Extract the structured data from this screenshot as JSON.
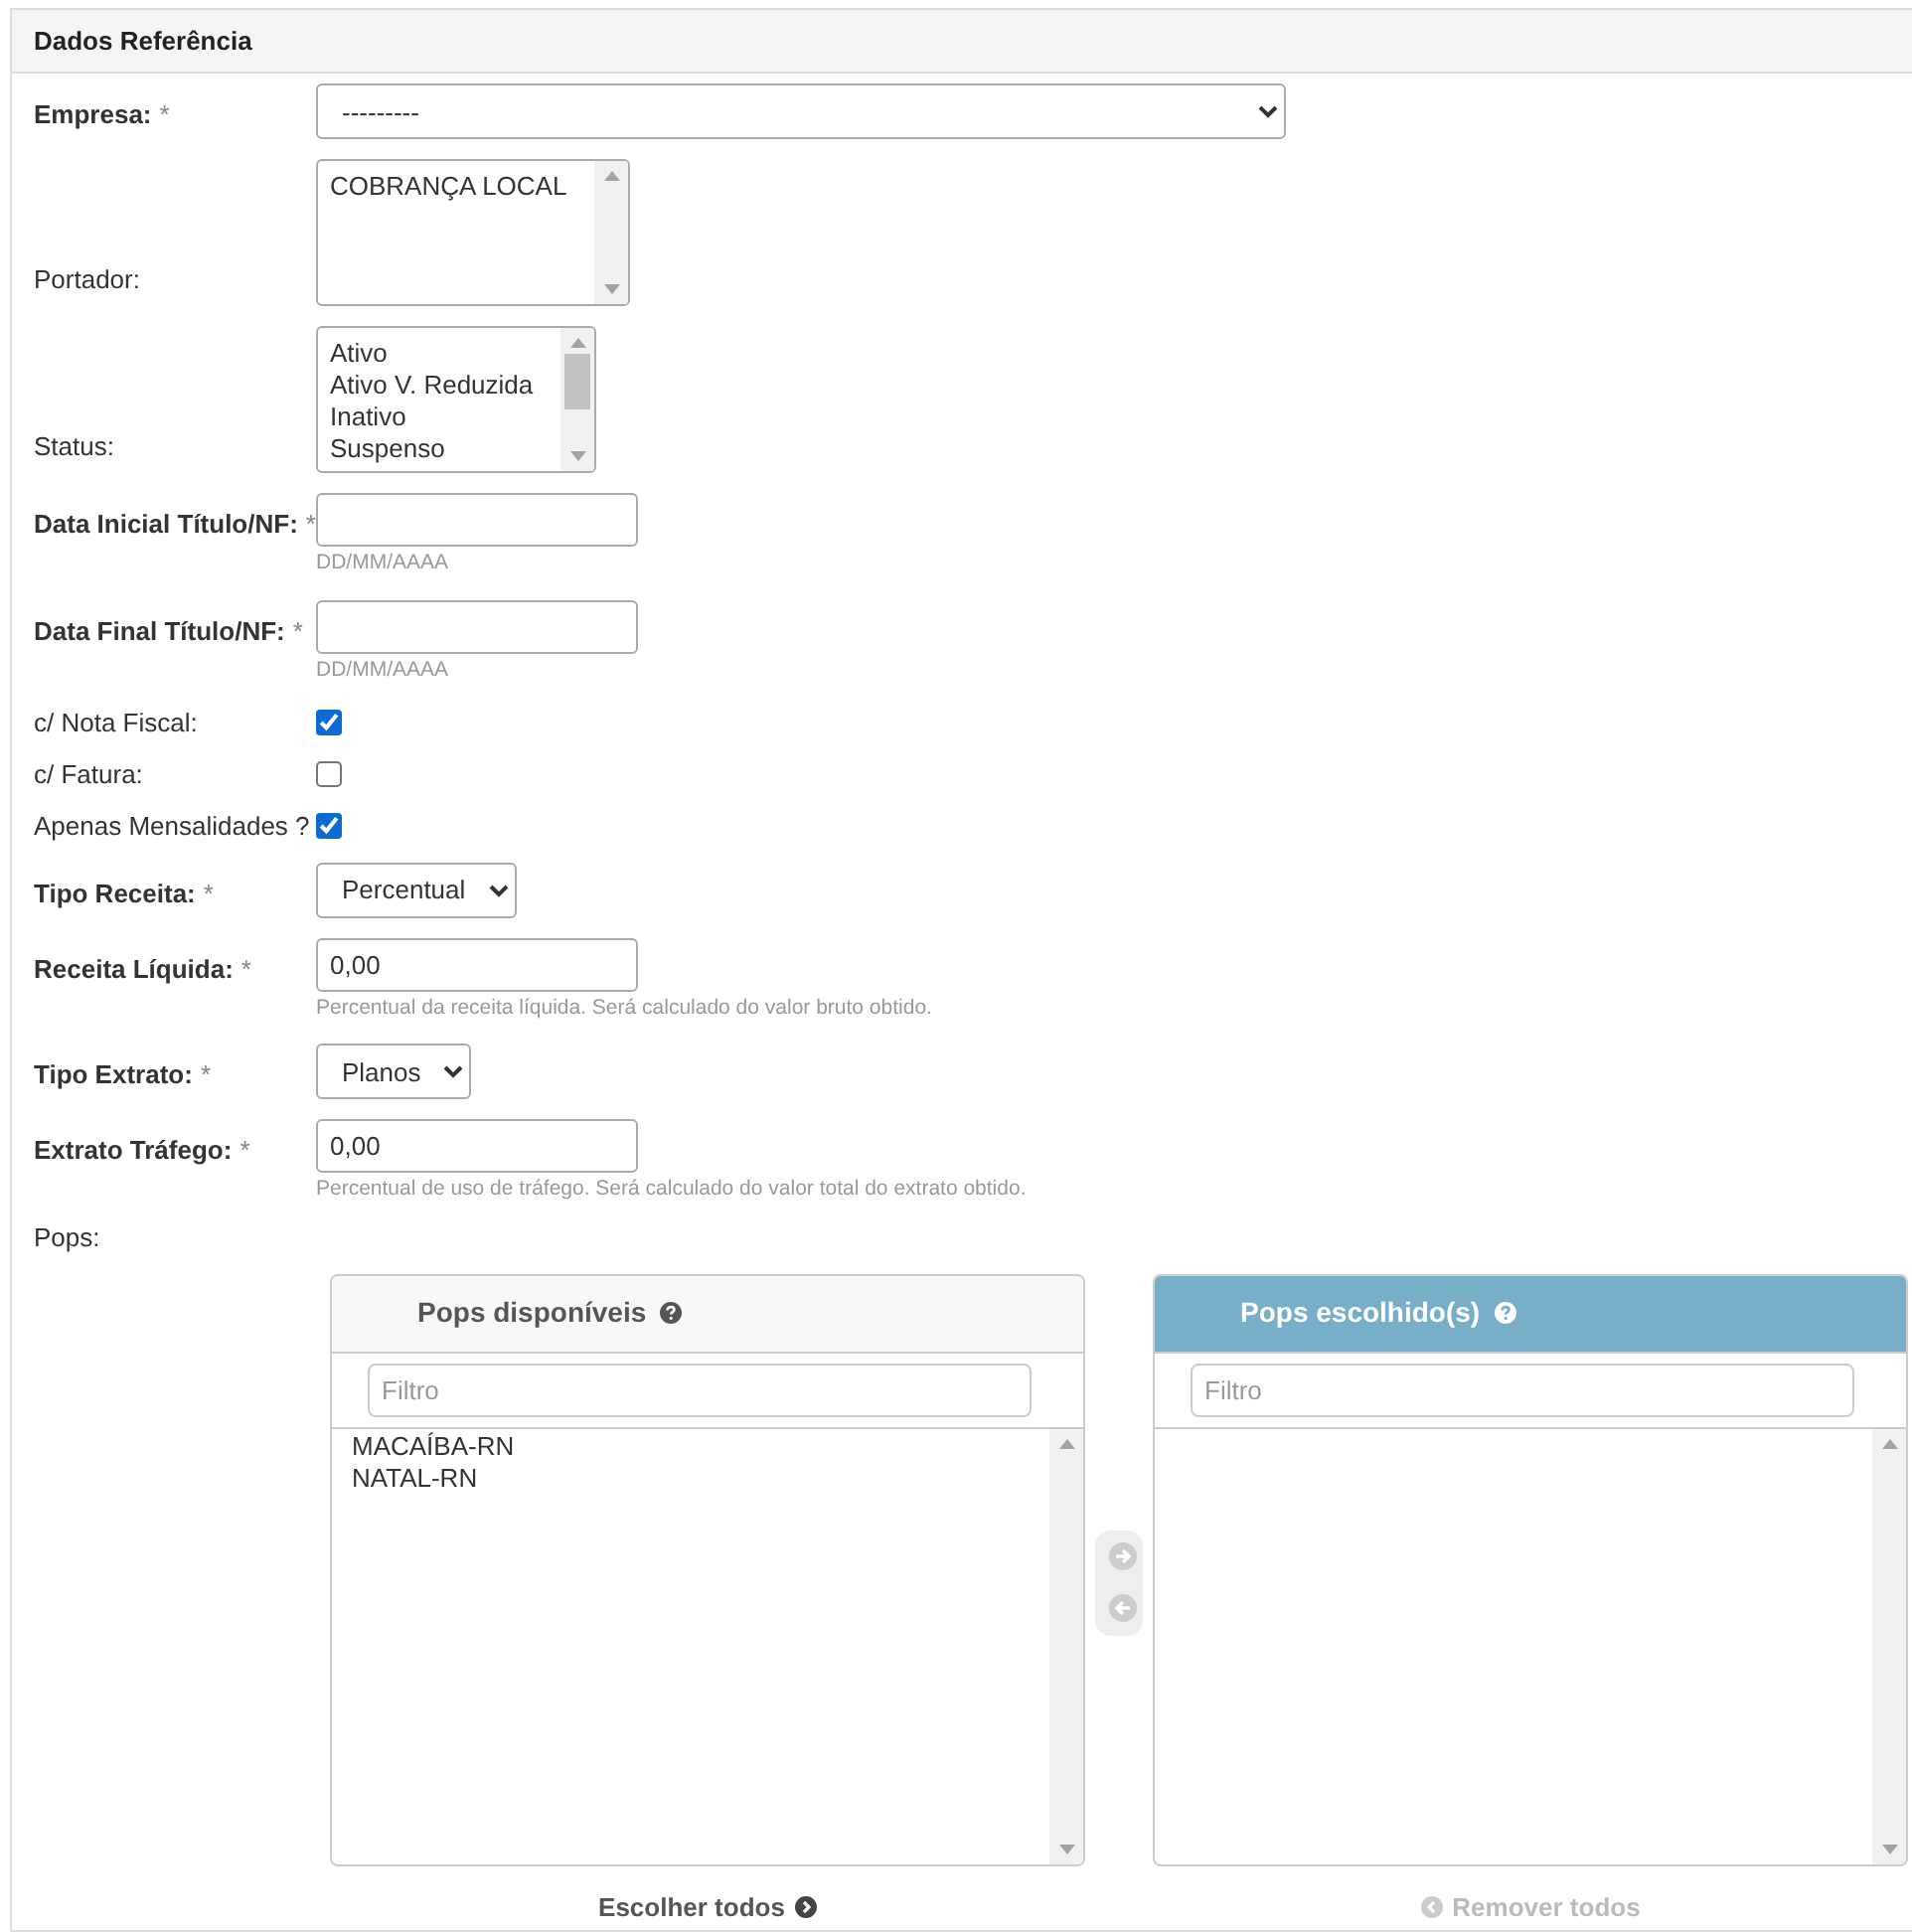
{
  "panel": {
    "title": "Dados Referência"
  },
  "fields": [
    {
      "kind": "select",
      "label": "Empresa:",
      "required_mark": "*",
      "value": "---------"
    },
    {
      "kind": "listbox",
      "label": "Portador:",
      "items": [
        "COBRANÇA LOCAL"
      ]
    },
    {
      "kind": "listbox",
      "label": "Status:",
      "items": [
        "Ativo",
        "Ativo V. Reduzida",
        "Inativo",
        "Suspenso"
      ]
    },
    {
      "kind": "text",
      "label": "Data Inicial Título/NF:",
      "required_mark": "*",
      "help": "DD/MM/AAAA"
    },
    {
      "kind": "text",
      "label": "Data Final Título/NF:",
      "required_mark": "*",
      "help": "DD/MM/AAAA"
    },
    {
      "kind": "checkbox",
      "label": "c/ Nota Fiscal:",
      "checked": true
    },
    {
      "kind": "checkbox",
      "label": "c/ Fatura:",
      "checked": false
    },
    {
      "kind": "checkbox",
      "label": "Apenas Mensalidades ?",
      "checked": true
    },
    {
      "kind": "select",
      "label": "Tipo Receita:",
      "required_mark": "*",
      "value": "Percentual"
    },
    {
      "kind": "text",
      "label": "Receita Líquida:",
      "required_mark": "*",
      "value": "0,00",
      "help": "Percentual da receita líquida. Será calculado do valor bruto obtido."
    },
    {
      "kind": "select",
      "label": "Tipo Extrato:",
      "required_mark": "*",
      "value": "Planos"
    },
    {
      "kind": "text",
      "label": "Extrato Tráfego:",
      "required_mark": "*",
      "value": "0,00",
      "help": "Percentual de uso de tráfego. Será calculado do valor total do extrato obtido."
    }
  ],
  "pops": {
    "label": "Pops:",
    "available": {
      "title": "Pops disponíveis",
      "filter_placeholder": "Filtro",
      "items": [
        "MACAÍBA-RN",
        "NATAL-RN"
      ]
    },
    "chosen": {
      "title": "Pops escolhido(s)",
      "filter_placeholder": "Filtro"
    },
    "choose_all": {
      "label": "Escolher todos",
      "disabled": false
    },
    "remove_all": {
      "label": "Remover todos",
      "disabled": true
    }
  }
}
